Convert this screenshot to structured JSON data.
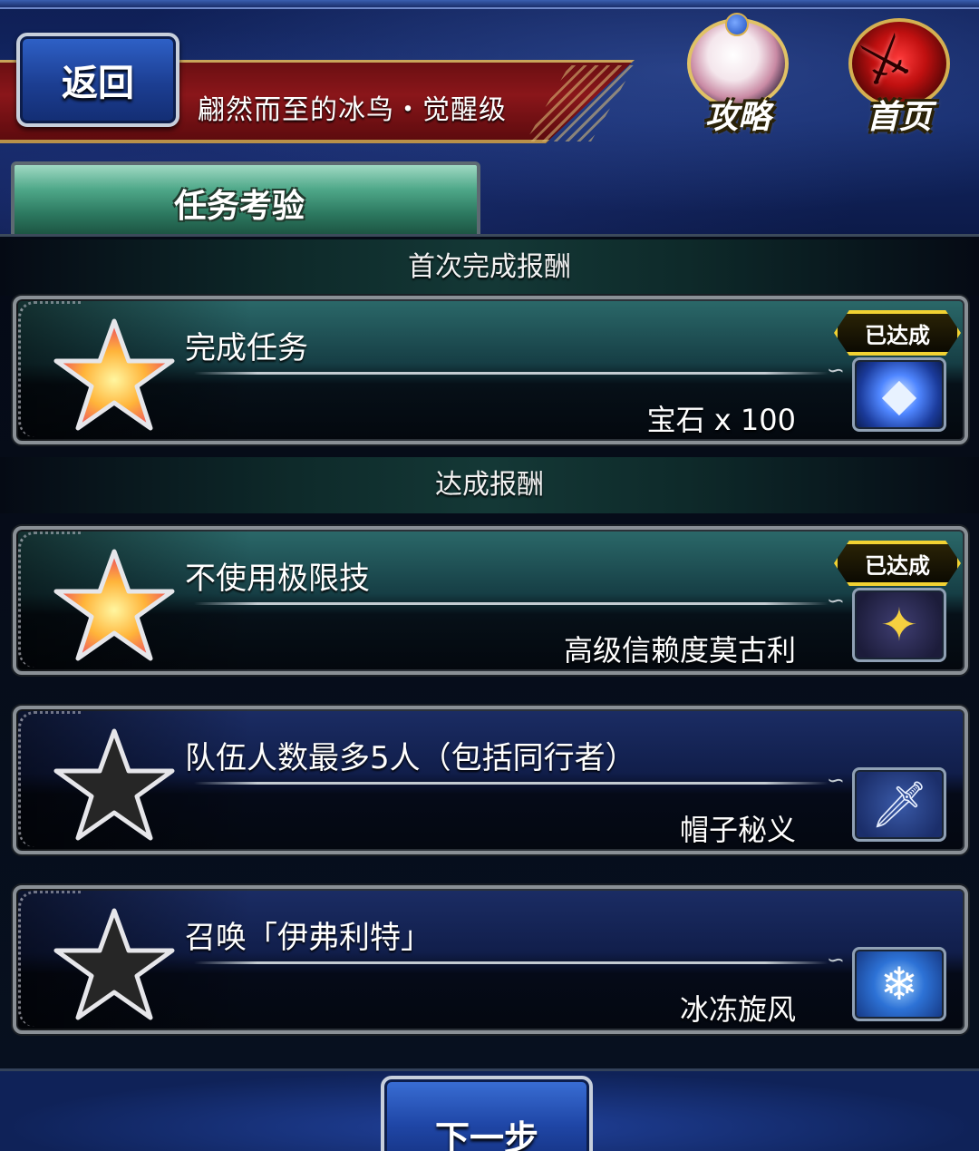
{
  "header": {
    "back_label": "返回",
    "quest_title": "翩然而至的冰鸟・觉醒级",
    "hint_label": "攻略",
    "home_label": "首页"
  },
  "tab": {
    "label": "任务考验"
  },
  "sections": {
    "first_clear": "首次完成报酬",
    "achievement": "达成报酬"
  },
  "missions": [
    {
      "title": "完成任务",
      "reward": "宝石 x 100",
      "achieved": true,
      "badge": "已达成",
      "icon": "gem-icon"
    },
    {
      "title": "不使用极限技",
      "reward": "高级信赖度莫古利",
      "achieved": true,
      "badge": "已达成",
      "icon": "moogle-icon"
    },
    {
      "title": "队伍人数最多5人（包括同行者）",
      "reward": "帽子秘义",
      "achieved": false,
      "icon": "sword-icon"
    },
    {
      "title": "召唤「伊弗利特」",
      "reward": "冰冻旋风",
      "achieved": false,
      "icon": "ice-icon"
    }
  ],
  "footer": {
    "next_label": "下一步"
  },
  "colors": {
    "achieved_star": "#ffcf3a",
    "unachieved_star": "#2a2a2a",
    "badge_border": "#f2d232",
    "tab_green": "#4fa889",
    "banner_red": "#8a161a"
  }
}
